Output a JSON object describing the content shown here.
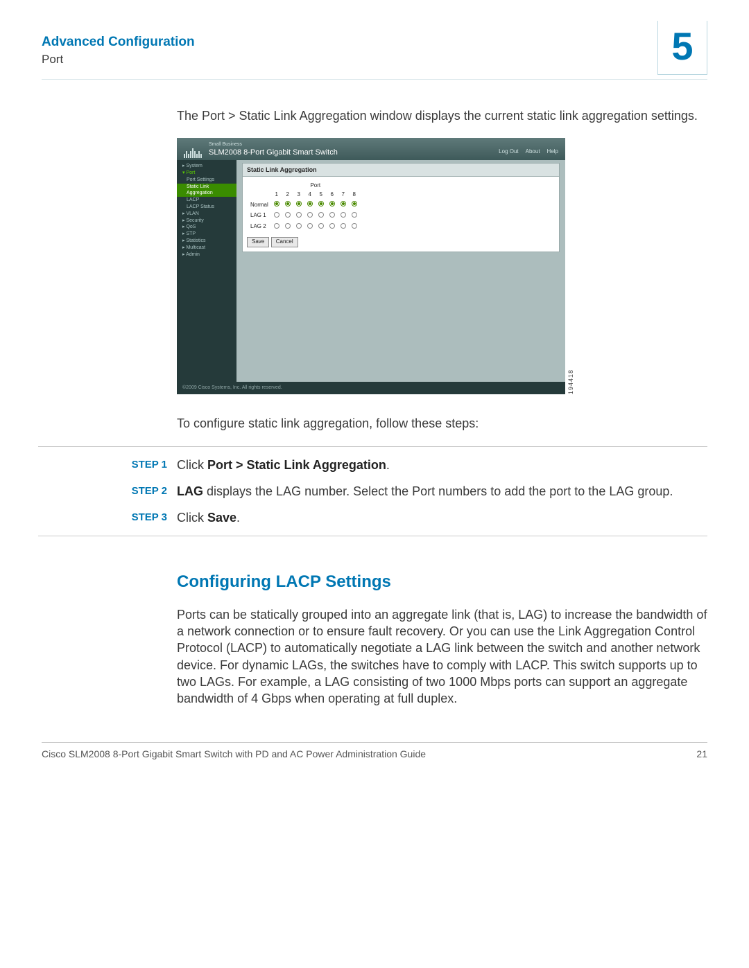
{
  "header": {
    "title": "Advanced Configuration",
    "subtitle": "Port",
    "chapter": "5"
  },
  "intro": "The Port > Static Link Aggregation window displays the current static link aggregation settings.",
  "screenshot": {
    "brand_small": "Small Business",
    "brand_title": "SLM2008 8-Port Gigabit Smart Switch",
    "links": [
      "Log Out",
      "About",
      "Help"
    ],
    "nav": {
      "system": "System",
      "port": "Port",
      "port_settings": "Port Settings",
      "static_link": "Static Link Aggregation",
      "lacp": "LACP",
      "lacp_status": "LACP Status",
      "vlan": "VLAN",
      "security": "Security",
      "qos": "QoS",
      "stp": "STP",
      "statistics": "Statistics",
      "multicast": "Multicast",
      "admin": "Admin"
    },
    "panel_title": "Static Link Aggregation",
    "port_header": "Port",
    "ports": [
      "1",
      "2",
      "3",
      "4",
      "5",
      "6",
      "7",
      "8"
    ],
    "rows": {
      "normal": "Normal",
      "lag1": "LAG 1",
      "lag2": "LAG 2"
    },
    "save": "Save",
    "cancel": "Cancel",
    "copyright": "©2009 Cisco Systems, Inc. All rights reserved.",
    "ref": "194418"
  },
  "after_shot": "To configure static link aggregation, follow these steps:",
  "steps": [
    {
      "label": "STEP 1",
      "prefix": "Click ",
      "bold": "Port > Static Link Aggregation",
      "suffix": "."
    },
    {
      "label": "STEP 2",
      "bold_first": "LAG",
      "rest": " displays the LAG number. Select the Port numbers to add the port to the LAG group."
    },
    {
      "label": "STEP 3",
      "prefix": "Click ",
      "bold": "Save",
      "suffix": "."
    }
  ],
  "section2": {
    "title": "Configuring LACP Settings",
    "body": "Ports can be statically grouped into an aggregate link (that is, LAG) to increase the bandwidth of a network connection or to ensure fault recovery. Or you can use the Link Aggregation Control Protocol (LACP) to automatically negotiate a LAG link between the switch and another network device. For dynamic LAGs, the switches have to comply with LACP. This switch supports up to two LAGs. For example, a LAG consisting of two 1000 Mbps ports can support an aggregate bandwidth of 4 Gbps when operating at full duplex."
  },
  "footer": {
    "left": "Cisco SLM2008 8-Port Gigabit Smart Switch with PD and AC Power Administration Guide",
    "right": "21"
  }
}
